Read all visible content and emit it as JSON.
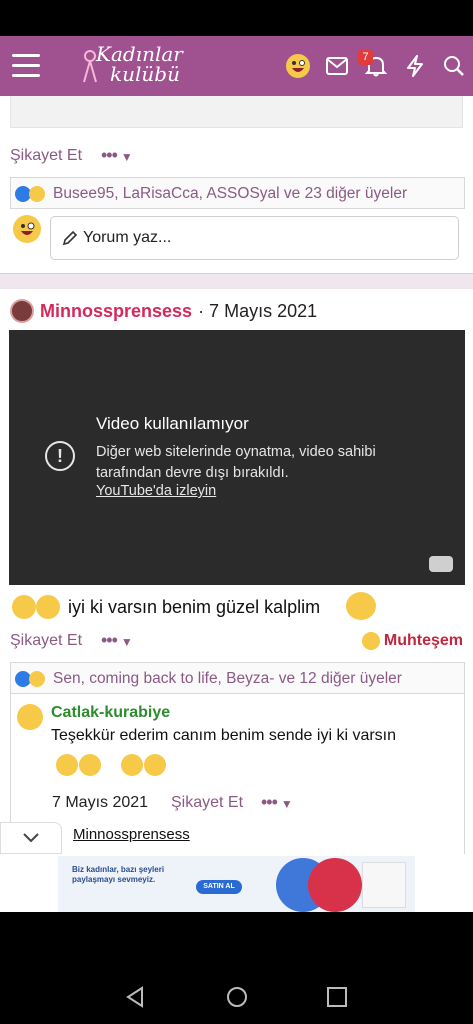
{
  "header": {
    "logo_line1": "Kadınlar",
    "logo_line2": "kulübü",
    "notification_count": "7",
    "brand_color": "#a0518f"
  },
  "previous_post": {
    "report_label": "Şikayet Et",
    "more_label": "•••",
    "reactions_text": "Busee95, LaRisaCca, ASSOSyal ve 23 diğer üyeler",
    "comment_placeholder": "Yorum yaz..."
  },
  "post": {
    "username": "Minnossprensess",
    "date": "· 7 Mayıs 2021",
    "video": {
      "title": "Video kullanılamıyor",
      "description": "Diğer web sitelerinde oynatma, video sahibi tarafından devre dışı bırakıldı.",
      "link": "YouTube'da izleyin"
    },
    "text": "iyi ki varsın benim güzel kalplim",
    "report_label": "Şikayet Et",
    "more_label": "•••",
    "reaction_label": "Muhteşem",
    "reactions_text": "Sen, coming back to life, Beyza- ve 12 diğer üyeler"
  },
  "reply": {
    "username": "Catlak-kurabiye",
    "text": "Teşekkür ederim canım benim sende iyi ki varsın",
    "date": "7 Mayıs 2021",
    "report_label": "Şikayet Et",
    "more_label": "•••",
    "quote_user": "Minnossprensess"
  },
  "ad": {
    "text": "Biz kadınlar, bazı şeyleri paylaşmayı sevmeyiz.",
    "button": "SATIN AL"
  }
}
